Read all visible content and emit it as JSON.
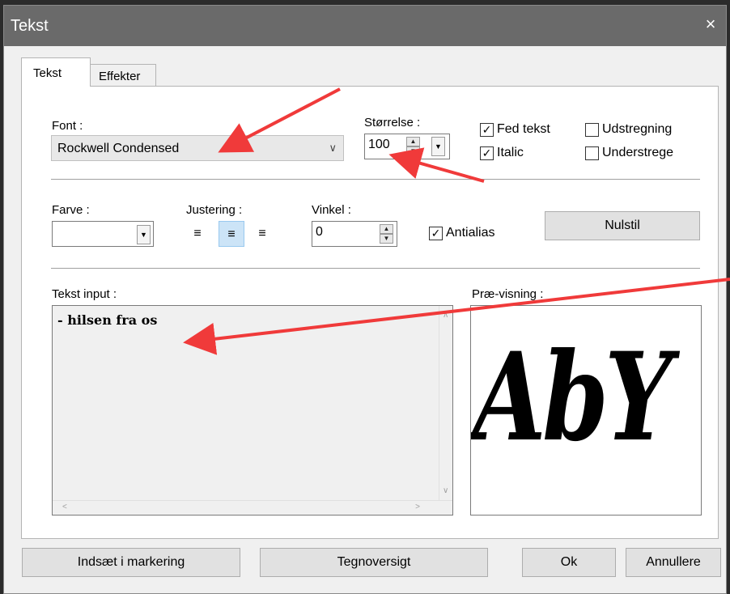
{
  "window": {
    "title": "Tekst",
    "close_icon": "×"
  },
  "tabs": [
    {
      "label": "Tekst",
      "active": true
    },
    {
      "label": "Effekter",
      "active": false
    }
  ],
  "font": {
    "label": "Font :",
    "value": "Rockwell Condensed"
  },
  "size": {
    "label": "Størrelse :",
    "value": "100"
  },
  "checkboxes": {
    "bold": {
      "label": "Fed tekst",
      "checked": true
    },
    "italic": {
      "label": "Italic",
      "checked": true
    },
    "strikeout": {
      "label": "Udstregning",
      "checked": false
    },
    "underline": {
      "label": "Understrege",
      "checked": false
    },
    "antialias": {
      "label": "Antialias",
      "checked": true
    }
  },
  "color": {
    "label": "Farve :"
  },
  "alignment": {
    "label": "Justering :",
    "selected": "center"
  },
  "angle": {
    "label": "Vinkel :",
    "value": "0"
  },
  "reset_button": "Nulstil",
  "text_input": {
    "label": "Tekst input :",
    "value": "- hilsen fra os"
  },
  "preview": {
    "label": "Præ-visning :",
    "sample": "AbY"
  },
  "buttons": {
    "insert": "Indsæt i markering",
    "charmap": "Tegnoversigt",
    "ok": "Ok",
    "cancel": "Annullere"
  },
  "colors": {
    "annotation_arrow": "#f03a3a",
    "selection": "#cce4f7"
  }
}
